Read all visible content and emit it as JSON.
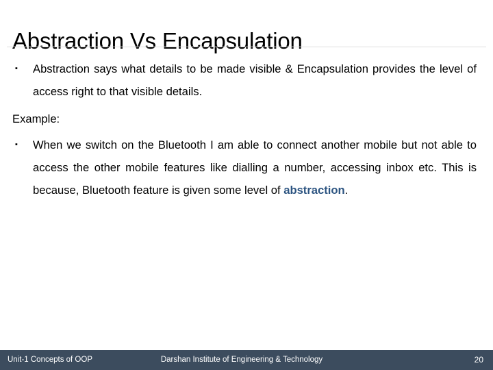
{
  "slide": {
    "title": "Abstraction Vs Encapsulation",
    "bullet_marker": "▪",
    "body": {
      "bullet_1": "Abstraction says what details to be made visible & Encapsulation provides the level of access right to that visible details.",
      "example_label": "Example:",
      "bullet_2_part1": "When we switch on the Bluetooth I am able to connect another mobile but not able to access the other mobile features like dialling a number, accessing inbox etc. This is because, Bluetooth feature is given some level of ",
      "bullet_2_accent": "abstraction",
      "bullet_2_part2": "."
    }
  },
  "footer": {
    "left": "Unit-1 Concepts of OOP",
    "center": "Darshan Institute of Engineering & Technology",
    "page_number": "20",
    "background_color": "#3c4c5e",
    "text_color": "#ffffff"
  },
  "colors": {
    "accent_blue": "#2c5481",
    "title_text": "#000000",
    "body_text": "#000000",
    "rule": "#dddddd"
  }
}
